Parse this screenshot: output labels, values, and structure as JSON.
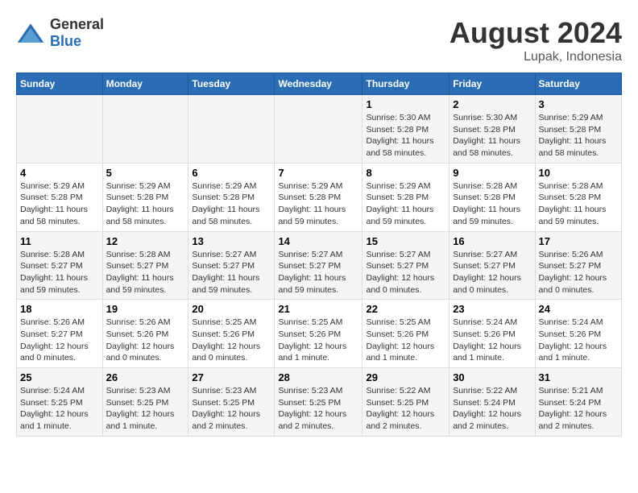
{
  "logo": {
    "text_general": "General",
    "text_blue": "Blue"
  },
  "header": {
    "month": "August 2024",
    "location": "Lupak, Indonesia"
  },
  "days_of_week": [
    "Sunday",
    "Monday",
    "Tuesday",
    "Wednesday",
    "Thursday",
    "Friday",
    "Saturday"
  ],
  "weeks": [
    [
      {
        "day": "",
        "info": ""
      },
      {
        "day": "",
        "info": ""
      },
      {
        "day": "",
        "info": ""
      },
      {
        "day": "",
        "info": ""
      },
      {
        "day": "1",
        "info": "Sunrise: 5:30 AM\nSunset: 5:28 PM\nDaylight: 11 hours\nand 58 minutes."
      },
      {
        "day": "2",
        "info": "Sunrise: 5:30 AM\nSunset: 5:28 PM\nDaylight: 11 hours\nand 58 minutes."
      },
      {
        "day": "3",
        "info": "Sunrise: 5:29 AM\nSunset: 5:28 PM\nDaylight: 11 hours\nand 58 minutes."
      }
    ],
    [
      {
        "day": "4",
        "info": "Sunrise: 5:29 AM\nSunset: 5:28 PM\nDaylight: 11 hours\nand 58 minutes."
      },
      {
        "day": "5",
        "info": "Sunrise: 5:29 AM\nSunset: 5:28 PM\nDaylight: 11 hours\nand 58 minutes."
      },
      {
        "day": "6",
        "info": "Sunrise: 5:29 AM\nSunset: 5:28 PM\nDaylight: 11 hours\nand 58 minutes."
      },
      {
        "day": "7",
        "info": "Sunrise: 5:29 AM\nSunset: 5:28 PM\nDaylight: 11 hours\nand 59 minutes."
      },
      {
        "day": "8",
        "info": "Sunrise: 5:29 AM\nSunset: 5:28 PM\nDaylight: 11 hours\nand 59 minutes."
      },
      {
        "day": "9",
        "info": "Sunrise: 5:28 AM\nSunset: 5:28 PM\nDaylight: 11 hours\nand 59 minutes."
      },
      {
        "day": "10",
        "info": "Sunrise: 5:28 AM\nSunset: 5:28 PM\nDaylight: 11 hours\nand 59 minutes."
      }
    ],
    [
      {
        "day": "11",
        "info": "Sunrise: 5:28 AM\nSunset: 5:27 PM\nDaylight: 11 hours\nand 59 minutes."
      },
      {
        "day": "12",
        "info": "Sunrise: 5:28 AM\nSunset: 5:27 PM\nDaylight: 11 hours\nand 59 minutes."
      },
      {
        "day": "13",
        "info": "Sunrise: 5:27 AM\nSunset: 5:27 PM\nDaylight: 11 hours\nand 59 minutes."
      },
      {
        "day": "14",
        "info": "Sunrise: 5:27 AM\nSunset: 5:27 PM\nDaylight: 11 hours\nand 59 minutes."
      },
      {
        "day": "15",
        "info": "Sunrise: 5:27 AM\nSunset: 5:27 PM\nDaylight: 12 hours\nand 0 minutes."
      },
      {
        "day": "16",
        "info": "Sunrise: 5:27 AM\nSunset: 5:27 PM\nDaylight: 12 hours\nand 0 minutes."
      },
      {
        "day": "17",
        "info": "Sunrise: 5:26 AM\nSunset: 5:27 PM\nDaylight: 12 hours\nand 0 minutes."
      }
    ],
    [
      {
        "day": "18",
        "info": "Sunrise: 5:26 AM\nSunset: 5:27 PM\nDaylight: 12 hours\nand 0 minutes."
      },
      {
        "day": "19",
        "info": "Sunrise: 5:26 AM\nSunset: 5:26 PM\nDaylight: 12 hours\nand 0 minutes."
      },
      {
        "day": "20",
        "info": "Sunrise: 5:25 AM\nSunset: 5:26 PM\nDaylight: 12 hours\nand 0 minutes."
      },
      {
        "day": "21",
        "info": "Sunrise: 5:25 AM\nSunset: 5:26 PM\nDaylight: 12 hours\nand 1 minute."
      },
      {
        "day": "22",
        "info": "Sunrise: 5:25 AM\nSunset: 5:26 PM\nDaylight: 12 hours\nand 1 minute."
      },
      {
        "day": "23",
        "info": "Sunrise: 5:24 AM\nSunset: 5:26 PM\nDaylight: 12 hours\nand 1 minute."
      },
      {
        "day": "24",
        "info": "Sunrise: 5:24 AM\nSunset: 5:26 PM\nDaylight: 12 hours\nand 1 minute."
      }
    ],
    [
      {
        "day": "25",
        "info": "Sunrise: 5:24 AM\nSunset: 5:25 PM\nDaylight: 12 hours\nand 1 minute."
      },
      {
        "day": "26",
        "info": "Sunrise: 5:23 AM\nSunset: 5:25 PM\nDaylight: 12 hours\nand 1 minute."
      },
      {
        "day": "27",
        "info": "Sunrise: 5:23 AM\nSunset: 5:25 PM\nDaylight: 12 hours\nand 2 minutes."
      },
      {
        "day": "28",
        "info": "Sunrise: 5:23 AM\nSunset: 5:25 PM\nDaylight: 12 hours\nand 2 minutes."
      },
      {
        "day": "29",
        "info": "Sunrise: 5:22 AM\nSunset: 5:25 PM\nDaylight: 12 hours\nand 2 minutes."
      },
      {
        "day": "30",
        "info": "Sunrise: 5:22 AM\nSunset: 5:24 PM\nDaylight: 12 hours\nand 2 minutes."
      },
      {
        "day": "31",
        "info": "Sunrise: 5:21 AM\nSunset: 5:24 PM\nDaylight: 12 hours\nand 2 minutes."
      }
    ]
  ]
}
